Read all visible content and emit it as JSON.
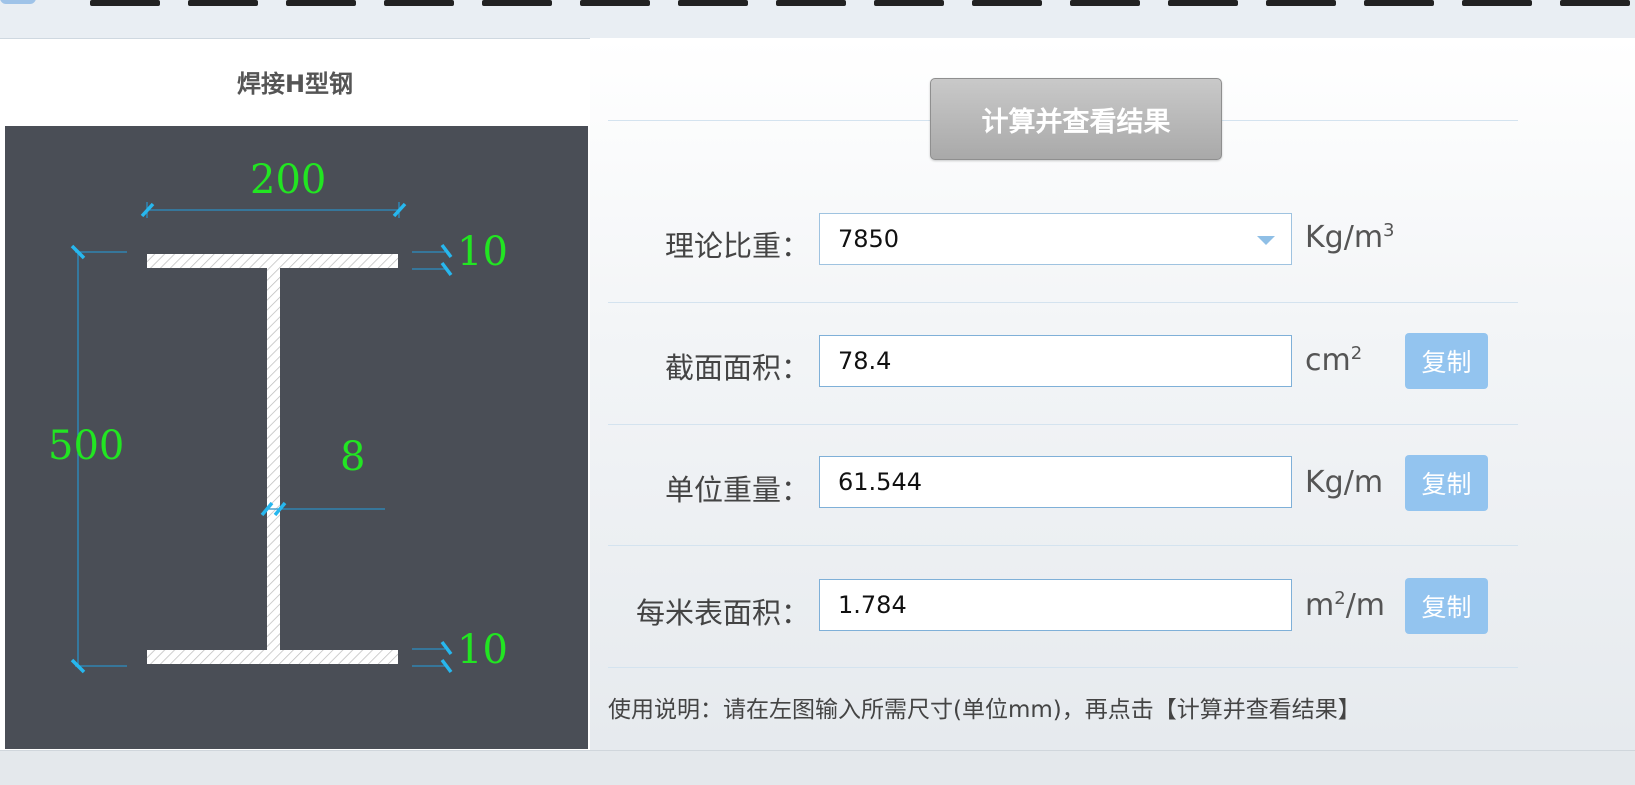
{
  "diagram": {
    "title": "焊接H型钢",
    "dim_width": "200",
    "dim_height": "500",
    "dim_web": "8",
    "dim_flange_top": "10",
    "dim_flange_bottom": "10"
  },
  "calc_button": "计算并查看结果",
  "rows": [
    {
      "label": "理论比重：",
      "value": "7850",
      "unit": "Kg/m",
      "unit_sup": "3"
    },
    {
      "label": "截面面积：",
      "value": "78.4",
      "unit": "cm",
      "unit_sup": "2",
      "copy": "复制"
    },
    {
      "label": "单位重量：",
      "value": "61.544",
      "unit": "Kg/m",
      "copy": "复制"
    },
    {
      "label": "每米表面积：",
      "value": "1.784",
      "unit": "m",
      "unit_sup": "2",
      "unit_suffix": "/m",
      "copy": "复制"
    }
  ],
  "instructions": "使用说明：请在左图输入所需尺寸(单位mm)，再点击【计算并查看结果】",
  "colors": {
    "diagram_bg": "#4a4e56",
    "dimension_text": "#22e522",
    "copy_button": "#93c4ef",
    "calc_button": "#b8b8b8"
  }
}
